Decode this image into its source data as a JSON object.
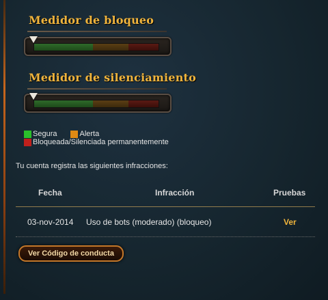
{
  "block_meter": {
    "title": "Medidor de bloqueo",
    "level": 0
  },
  "silence_meter": {
    "title": "Medidor de silenciamiento",
    "level": 0
  },
  "legend": {
    "safe": {
      "label": "Segura",
      "color": "#2bbf2b"
    },
    "warning": {
      "label": "Alerta",
      "color": "#e08a14"
    },
    "banned": {
      "label": "Bloqueada/Silenciada permanentemente",
      "color": "#c0201c"
    }
  },
  "infractions": {
    "intro": "Tu cuenta registra las siguientes infracciones:",
    "columns": {
      "date": "Fecha",
      "infraction": "Infracción",
      "evidence": "Pruebas"
    },
    "rows": [
      {
        "date": "03-nov-2014",
        "infraction": "Uso de bots (moderado) (bloqueo)",
        "evidence": "Ver"
      }
    ]
  },
  "code_of_conduct_button": "Ver Código de conducta",
  "colors": {
    "accent_gold": "#f0b43c",
    "button_border": "#c4782a"
  }
}
